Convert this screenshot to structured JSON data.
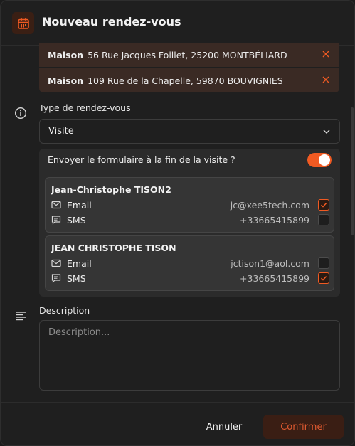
{
  "header": {
    "title": "Nouveau rendez-vous",
    "icon": "calendar-icon"
  },
  "addresses": [
    {
      "label": "Maison",
      "text": "56 Rue Jacques Foillet, 25200 MONTBÉLIARD"
    },
    {
      "label": "Maison",
      "text": "109 Rue de la Chapelle, 59870 BOUVIGNIES"
    }
  ],
  "appointment_type": {
    "label": "Type de rendez-vous",
    "value": "Visite"
  },
  "send_form": {
    "label": "Envoyer le formulaire à la fin de la visite ?",
    "enabled": true
  },
  "contacts": [
    {
      "name": "Jean-Christophe TISON2",
      "email_label": "Email",
      "email": "jc@xee5tech.com",
      "email_checked": true,
      "sms_label": "SMS",
      "phone": "+33665415899",
      "sms_checked": false
    },
    {
      "name": "JEAN CHRISTOPHE TISON",
      "email_label": "Email",
      "email": "jctison1@aol.com",
      "email_checked": false,
      "sms_label": "SMS",
      "phone": "+33665415899",
      "sms_checked": true
    }
  ],
  "description": {
    "label": "Description",
    "placeholder": "Description..."
  },
  "footer": {
    "cancel_label": "Annuler",
    "confirm_label": "Confirmer"
  },
  "colors": {
    "accent": "#f05a22",
    "background": "#1f1f1f",
    "panel": "#2b2b2b",
    "address_bg": "#3a2a24"
  }
}
